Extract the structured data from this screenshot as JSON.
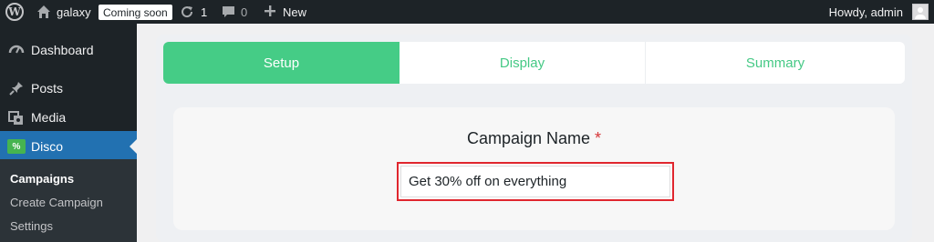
{
  "adminbar": {
    "site_name": "galaxy",
    "coming_soon_badge": "Coming soon",
    "updates_count": "1",
    "comments_count": "0",
    "new_label": "New",
    "howdy": "Howdy, admin"
  },
  "sidebar": {
    "items": [
      {
        "label": "Dashboard",
        "icon": "dashboard-icon"
      },
      {
        "label": "Posts",
        "icon": "pin-icon"
      },
      {
        "label": "Media",
        "icon": "media-icon"
      },
      {
        "label": "Disco",
        "icon": "disco-icon"
      }
    ],
    "submenu": [
      {
        "label": "Campaigns"
      },
      {
        "label": "Create Campaign"
      },
      {
        "label": "Settings"
      }
    ]
  },
  "tabs": [
    {
      "label": "Setup"
    },
    {
      "label": "Display"
    },
    {
      "label": "Summary"
    }
  ],
  "form": {
    "field_label": "Campaign Name",
    "required_mark": "*",
    "campaign_name_value": "Get 30% off on everything"
  },
  "colors": {
    "accent_green": "#45cc86",
    "admin_blue": "#2271b1",
    "highlight_red": "#e0262e"
  }
}
